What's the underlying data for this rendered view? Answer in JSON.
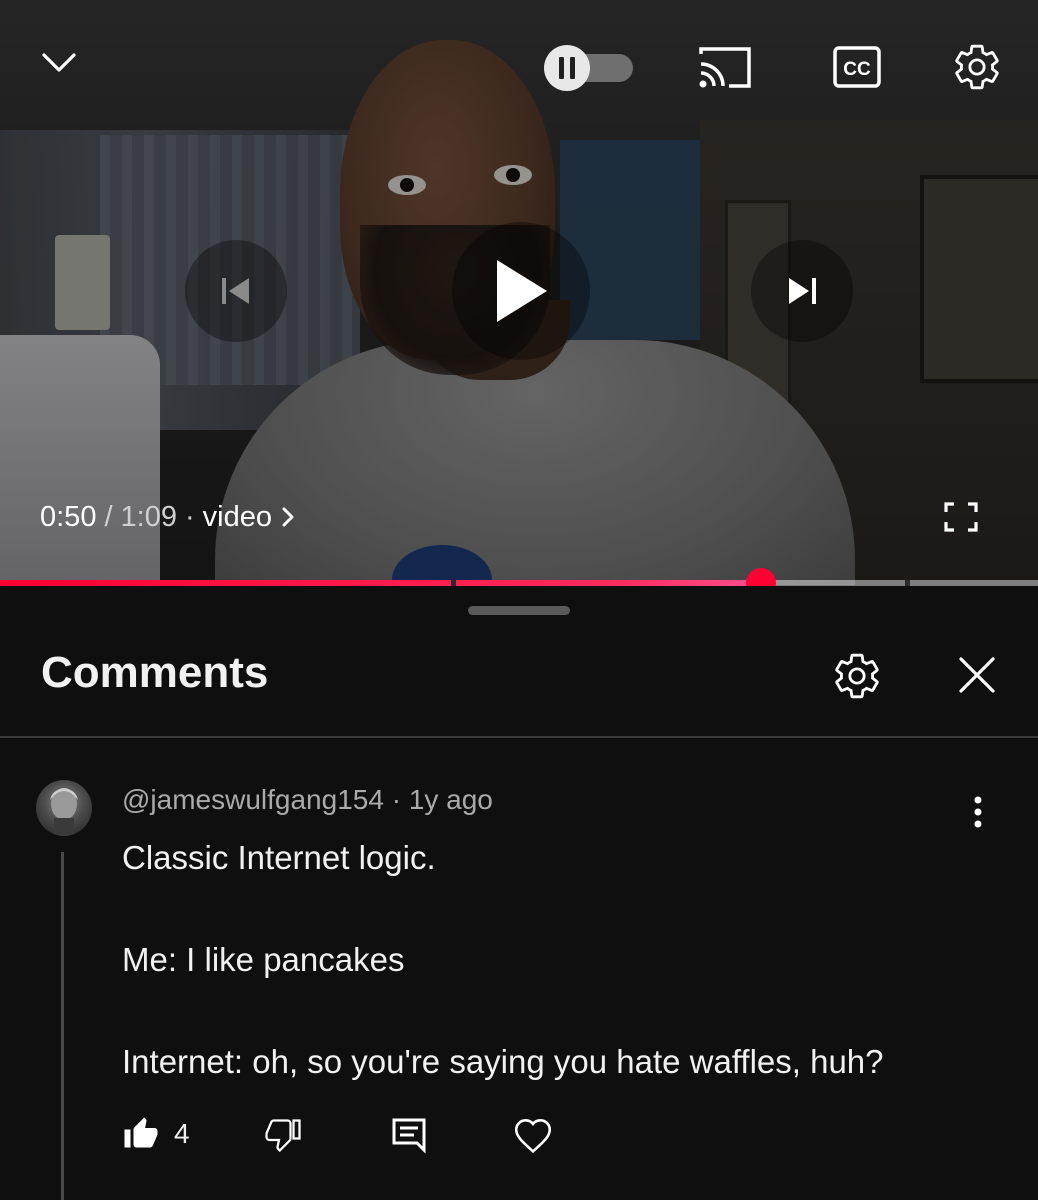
{
  "player": {
    "current_time": "0:50",
    "separator": "/",
    "duration": "1:09",
    "dot": "·",
    "chapter_label": "video",
    "progress_fraction": 0.733,
    "accent_color": "#ff0033",
    "icons": {
      "collapse": "chevron-down-icon",
      "autoplay": "autoplay-toggle",
      "cast": "cast-icon",
      "captions": "cc-icon",
      "settings": "gear-icon",
      "previous": "skip-previous-icon",
      "play": "play-icon",
      "next": "skip-next-icon",
      "fullscreen": "fullscreen-icon"
    },
    "cc_text": "CC"
  },
  "comments_panel": {
    "title": "Comments",
    "icons": {
      "settings": "gear-icon",
      "close": "close-icon"
    }
  },
  "comment": {
    "author": "@jameswulfgang154",
    "meta_separator": "·",
    "age": "1y ago",
    "lines": [
      "Classic Internet logic.",
      "",
      "Me: I like pancakes",
      "",
      "Internet: oh, so you're saying you hate waffles, huh?"
    ],
    "likes": "4",
    "icons": {
      "more": "more-vert-icon",
      "like": "thumb-up-icon",
      "dislike": "thumb-down-icon",
      "reply": "reply-icon",
      "heart": "heart-icon"
    }
  }
}
